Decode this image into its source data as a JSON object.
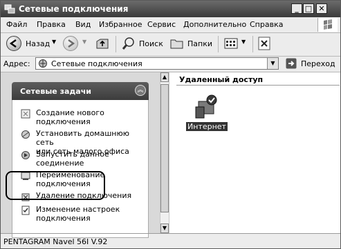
{
  "window": {
    "title": "Сетевые подключения"
  },
  "menu": [
    "Файл",
    "Правка",
    "Вид",
    "Избранное",
    "Сервис",
    "Дополнительно",
    "Справка"
  ],
  "toolbar": {
    "back": "Назад",
    "search": "Поиск",
    "folders": "Папки"
  },
  "address": {
    "label": "Адрес:",
    "value": "Сетевые подключения",
    "go": "Переход"
  },
  "tasks": {
    "title": "Сетевые задачи",
    "items": [
      {
        "line1": "Создание нового",
        "line2": "подключения"
      },
      {
        "line1": "Установить домашнюю сеть",
        "line2": "или сеть малого офиса"
      },
      {
        "line1": "Запустить данное",
        "line2": "соединение"
      },
      {
        "line1": "Переименование",
        "line2": "подключения"
      },
      {
        "line1": "Удаление подключения",
        "line2": ""
      },
      {
        "line1": "Изменение настроек",
        "line2": "подключения"
      }
    ]
  },
  "main": {
    "group_header": "Удаленный доступ",
    "connection_name": "Интернет"
  },
  "status": {
    "text": "PENTAGRAM Navel 56I V.92"
  }
}
